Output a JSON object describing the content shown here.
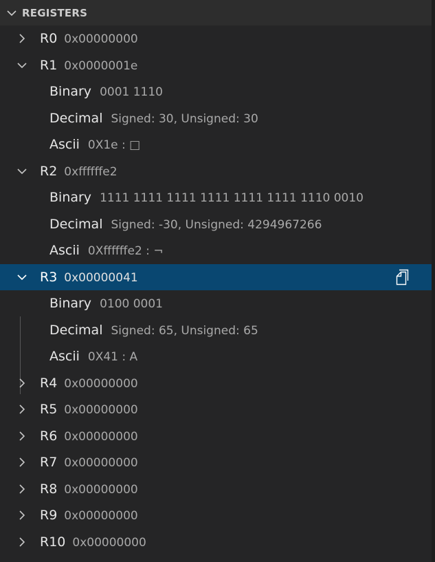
{
  "header": {
    "title": "REGISTERS"
  },
  "registers": [
    {
      "name": "R0",
      "value": "0x00000000",
      "expanded": false
    },
    {
      "name": "R1",
      "value": "0x0000001e",
      "expanded": true,
      "binary_label": "Binary",
      "binary": "0001 1110",
      "decimal_label": "Decimal",
      "decimal": "Signed: 30, Unsigned: 30",
      "ascii_label": "Ascii",
      "ascii": "0X1e : □"
    },
    {
      "name": "R2",
      "value": "0xffffffe2",
      "expanded": true,
      "binary_label": "Binary",
      "binary": "1111 1111 1111 1111 1111 1111 1110 0010",
      "decimal_label": "Decimal",
      "decimal": "Signed: -30, Unsigned: 4294967266",
      "ascii_label": "Ascii",
      "ascii": "0Xffffffe2 : ¬"
    },
    {
      "name": "R3",
      "value": "0x00000041",
      "expanded": true,
      "selected": true,
      "binary_label": "Binary",
      "binary": "0100 0001",
      "decimal_label": "Decimal",
      "decimal": "Signed: 65, Unsigned: 65",
      "ascii_label": "Ascii",
      "ascii": "0X41 : A"
    },
    {
      "name": "R4",
      "value": "0x00000000",
      "expanded": false
    },
    {
      "name": "R5",
      "value": "0x00000000",
      "expanded": false
    },
    {
      "name": "R6",
      "value": "0x00000000",
      "expanded": false
    },
    {
      "name": "R7",
      "value": "0x00000000",
      "expanded": false
    },
    {
      "name": "R8",
      "value": "0x00000000",
      "expanded": false
    },
    {
      "name": "R9",
      "value": "0x00000000",
      "expanded": false
    },
    {
      "name": "R10",
      "value": "0x00000000",
      "expanded": false
    }
  ],
  "icons": {
    "collapse": "chevron-down-icon",
    "expand": "chevron-right-icon",
    "copy": "copy-icon"
  },
  "colors": {
    "background": "#252526",
    "header_background": "#2d2d2d",
    "selection": "#094771",
    "label_text": "#e6e6e6",
    "value_text": "#a9a9a9"
  }
}
